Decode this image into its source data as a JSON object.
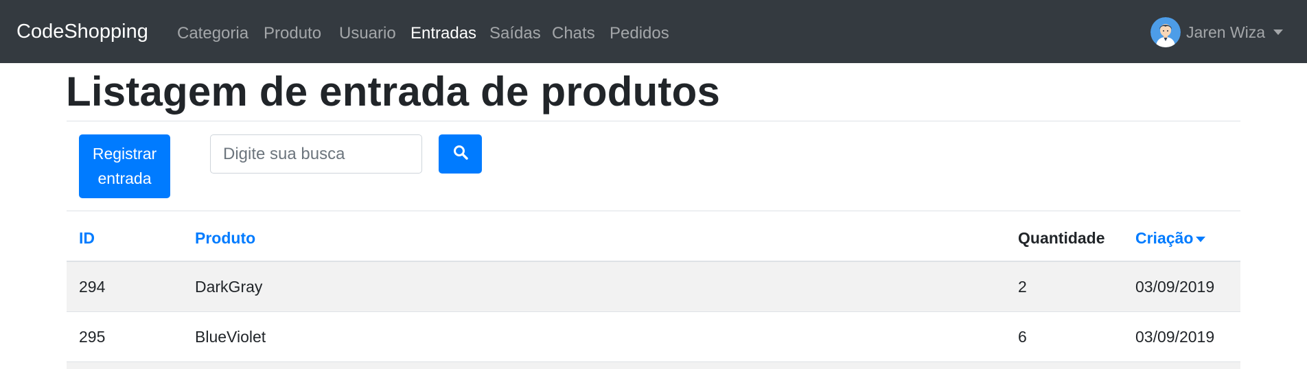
{
  "navbar": {
    "brand": "CodeShopping",
    "items": [
      {
        "label": "Categoria",
        "active": false
      },
      {
        "label": "Produto",
        "active": false
      },
      {
        "label": "Usuario",
        "active": false
      },
      {
        "label": "Entradas",
        "active": true
      },
      {
        "label": "Saídas",
        "active": false
      },
      {
        "label": "Chats",
        "active": false
      },
      {
        "label": "Pedidos",
        "active": false
      }
    ],
    "user": {
      "name": "Jaren Wiza",
      "avatar_icon": "user-avatar-icon",
      "dropdown_icon": "caret-down-icon"
    }
  },
  "page": {
    "title": "Listagem de entrada de produtos"
  },
  "actions": {
    "register_label_line1": "Registrar",
    "register_label_line2": "entrada",
    "search_placeholder": "Digite sua busca",
    "search_value": "",
    "search_icon": "search-icon"
  },
  "table": {
    "headers": {
      "id": "ID",
      "produto": "Produto",
      "quantidade": "Quantidade",
      "criacao": "Criação"
    },
    "sort": {
      "column": "criacao",
      "direction": "desc",
      "icon": "caret-down-icon"
    },
    "rows": [
      {
        "id": "294",
        "produto": "DarkGray",
        "quantidade": "2",
        "criacao": "03/09/2019"
      },
      {
        "id": "295",
        "produto": "BlueViolet",
        "quantidade": "6",
        "criacao": "03/09/2019"
      }
    ]
  },
  "colors": {
    "navbar_bg": "#343a40",
    "primary": "#007bff",
    "stripe": "#f2f2f2",
    "border": "#dee2e6"
  }
}
